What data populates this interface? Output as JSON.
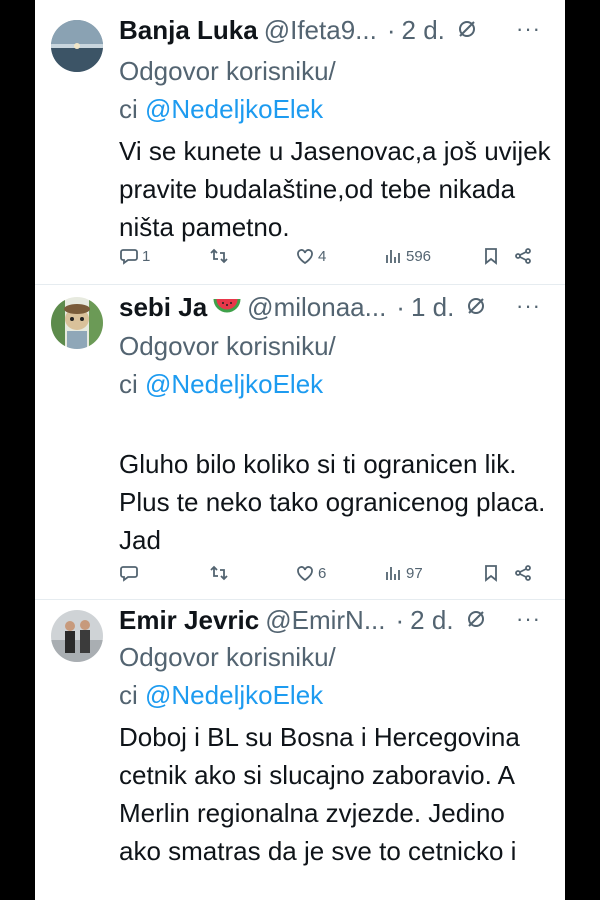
{
  "reply_prefix": "Odgovor korisniku/",
  "reply_suffix": "ci",
  "tweets": [
    {
      "name": "Banja Luka",
      "handle": "@Ifeta9...",
      "time": "2 d.",
      "reply_to": "@NedeljkoElek",
      "text": "Vi se kunete u Jasenovac,a još uvijek pravite budalaštine,od tebe nikada ništa pametno.",
      "replies": "1",
      "retweets": "",
      "likes": "4",
      "views": "596"
    },
    {
      "name": "sebi Ja",
      "handle": "@milonaa...",
      "time": "1 d.",
      "reply_to": "@NedeljkoElek",
      "text": "Gluho bilo koliko si ti ogranicen lik.\nPlus te neko tako ogranicenog placa. Jad",
      "replies": "",
      "retweets": "",
      "likes": "6",
      "views": "97"
    },
    {
      "name": "Emir Jevric",
      "handle": "@EmirN...",
      "time": "2 d.",
      "reply_to": "@NedeljkoElek",
      "text": "Doboj i BL su Bosna i Hercegovina cetnik ako si slucajno zaboravio. A Merlin regionalna zvjezde. Jedino ako smatras da je sve to cetnicko i",
      "replies": "",
      "retweets": "",
      "likes": "",
      "views": ""
    }
  ],
  "icons": {
    "reply": "speech-bubble-icon",
    "retweet": "retweet-icon",
    "like": "heart-icon",
    "views": "bar-chart-icon",
    "bookmark": "bookmark-icon",
    "share": "share-icon",
    "grok": "grok-icon",
    "more": "more-dots-icon",
    "emoji": "watermelon-emoji"
  },
  "colors": {
    "link": "#1d9bf0",
    "muted": "#536471",
    "text": "#0f1419"
  }
}
